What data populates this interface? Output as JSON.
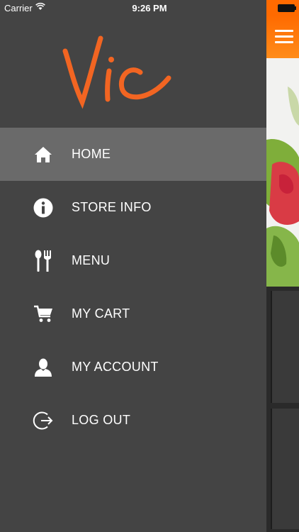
{
  "status_bar": {
    "carrier": "Carrier",
    "time": "9:26 PM"
  },
  "logo": {
    "text": "Vic",
    "color": "#f26522"
  },
  "menu": {
    "items": [
      {
        "label": "HOME",
        "icon": "home-icon",
        "active": true
      },
      {
        "label": "STORE INFO",
        "icon": "info-icon",
        "active": false
      },
      {
        "label": "MENU",
        "icon": "utensils-icon",
        "active": false
      },
      {
        "label": "MY CART",
        "icon": "cart-icon",
        "active": false
      },
      {
        "label": "MY ACCOUNT",
        "icon": "user-icon",
        "active": false
      },
      {
        "label": "LOG OUT",
        "icon": "logout-icon",
        "active": false
      }
    ]
  },
  "colors": {
    "drawer_bg": "#444444",
    "active_bg": "#6a6a6a",
    "accent": "#ff6a00"
  }
}
